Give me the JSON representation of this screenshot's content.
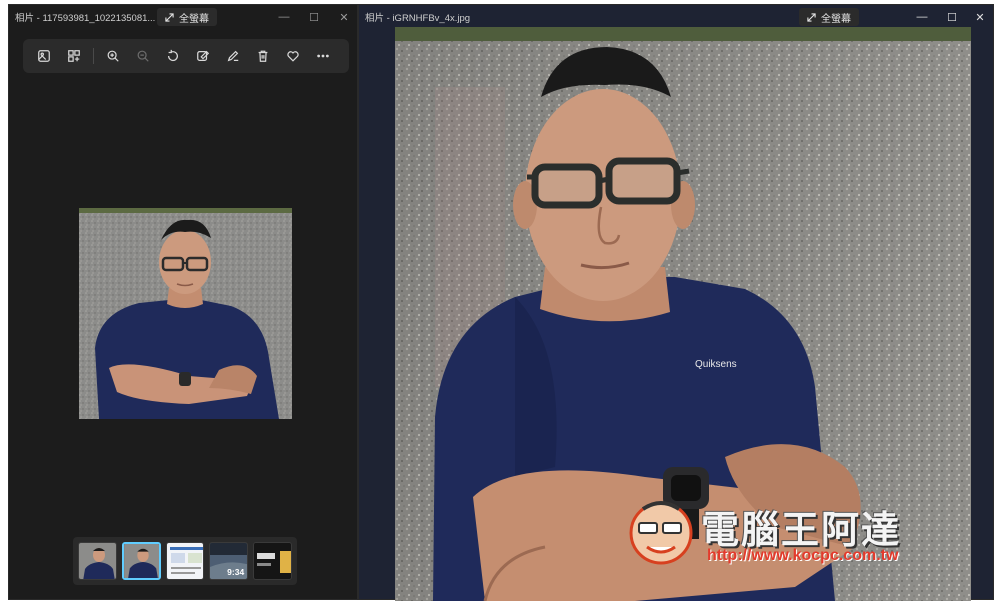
{
  "left_window": {
    "title": "相片 - 117593981_1022135081...",
    "fullscreen_label": "全螢幕",
    "toolbar": {
      "items": [
        {
          "name": "image-icon"
        },
        {
          "name": "collection-icon"
        },
        {
          "name": "zoom-in-icon"
        },
        {
          "name": "zoom-out-icon"
        },
        {
          "name": "rotate-icon"
        },
        {
          "name": "edit-image-icon"
        },
        {
          "name": "draw-icon"
        },
        {
          "name": "delete-icon"
        },
        {
          "name": "favorite-icon"
        },
        {
          "name": "more-icon"
        }
      ]
    },
    "filmstrip": {
      "thumbnails": [
        {
          "label": ""
        },
        {
          "label": "",
          "selected": true
        },
        {
          "label": ""
        },
        {
          "label": "9:34"
        },
        {
          "label": ""
        }
      ]
    }
  },
  "right_window": {
    "title": "相片 - iGRNHFBv_4x.jpg",
    "fullscreen_label": "全螢幕",
    "photo_logo": "Quiksens",
    "watermark_text": "電腦王阿達",
    "watermark_url": "http://www.kocpc.com.tw"
  },
  "colors": {
    "window_bg": "#1c1c1c",
    "toolbar_bg": "#2b2b2b",
    "accent": "#60cdff",
    "shirt": "#1f2a5a",
    "watermark_red": "#e33a2c"
  }
}
